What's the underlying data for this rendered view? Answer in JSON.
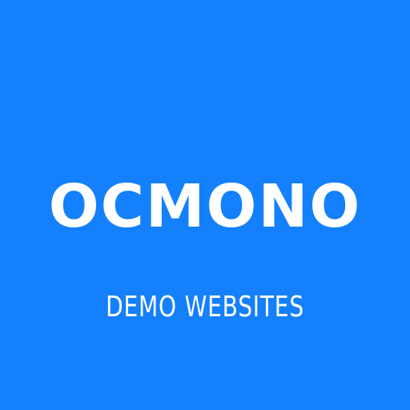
{
  "brand": {
    "logo_text": "OCMONO",
    "tagline": "DEMO WEBSITES"
  },
  "colors": {
    "background": "#1480FB",
    "text": "#FFFFFF"
  }
}
